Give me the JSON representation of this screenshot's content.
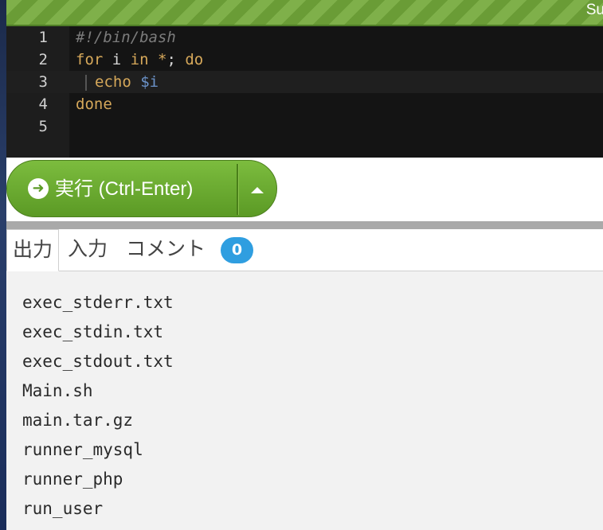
{
  "status": {
    "text": "Su"
  },
  "editor": {
    "lines": [
      {
        "num": "1",
        "tokens": [
          {
            "t": "#!/bin/bash",
            "c": "comment"
          }
        ]
      },
      {
        "num": "2",
        "tokens": [
          {
            "t": "for",
            "c": "kw"
          },
          {
            "t": " i ",
            "c": "var"
          },
          {
            "t": "in",
            "c": "kw"
          },
          {
            "t": " *",
            "c": "op"
          },
          {
            "t": "; ",
            "c": "var"
          },
          {
            "t": "do",
            "c": "kw"
          }
        ]
      },
      {
        "num": "3",
        "indent": true,
        "tokens": [
          {
            "t": "echo",
            "c": "builtin"
          },
          {
            "t": " ",
            "c": "var"
          },
          {
            "t": "$i",
            "c": "dollar"
          }
        ]
      },
      {
        "num": "4",
        "tokens": [
          {
            "t": "done",
            "c": "kw"
          }
        ]
      },
      {
        "num": "5",
        "tokens": []
      }
    ],
    "active_line": 3
  },
  "run": {
    "icon": "arrow-right-circle-icon",
    "label": "実行 (Ctrl-Enter)",
    "menu_icon": "caret-up-icon"
  },
  "tabs": {
    "output": "出力",
    "input": "入力",
    "comment": "コメント",
    "comment_count": "0"
  },
  "output": {
    "lines": [
      "exec_stderr.txt",
      "exec_stdin.txt",
      "exec_stdout.txt",
      "Main.sh",
      "main.tar.gz",
      "runner_mysql",
      "runner_php",
      "run_user"
    ]
  },
  "colors": {
    "accent_green": "#6a9c36",
    "badge_blue": "#2f9ee0",
    "editor_bg": "#141414"
  }
}
